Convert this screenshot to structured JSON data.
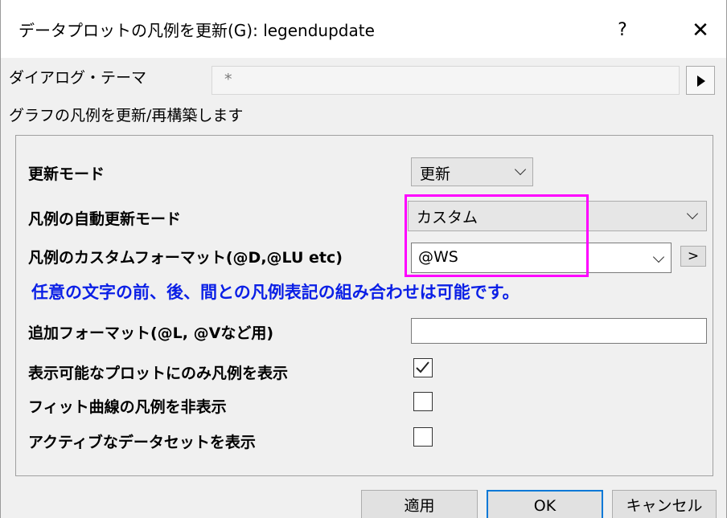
{
  "window": {
    "title": "データプロットの凡例を更新(G): legendupdate",
    "help_label": "?",
    "close_label": "✕"
  },
  "theme": {
    "label": "ダイアログ・テーマ",
    "value": "*"
  },
  "description": "グラフの凡例を更新/再構築します",
  "fields": {
    "update_mode": {
      "label": "更新モード",
      "value": "更新"
    },
    "auto_update_mode": {
      "label": "凡例の自動更新モード",
      "value": "カスタム"
    },
    "custom_format": {
      "label": "凡例のカスタムフォーマット(@D,@LU etc)",
      "value": "@WS",
      "expand_label": ">"
    },
    "note": "任意の文字の前、後、間との凡例表記の組み合わせは可能です。",
    "extra_format": {
      "label": "追加フォーマット(@L, @Vなど用)",
      "value": ""
    },
    "visible_only": {
      "label": "表示可能なプロットにのみ凡例を表示",
      "checked": true
    },
    "hide_fit": {
      "label": "フィット曲線の凡例を非表示",
      "checked": false
    },
    "show_active": {
      "label": "アクティブなデータセットを表示",
      "checked": false
    }
  },
  "buttons": {
    "apply": "適用",
    "ok": "OK",
    "cancel": "キャンセル"
  },
  "colors": {
    "highlight": "#ff00ff",
    "note_text": "#0a1fe6",
    "default_button_border": "#0078d7"
  }
}
